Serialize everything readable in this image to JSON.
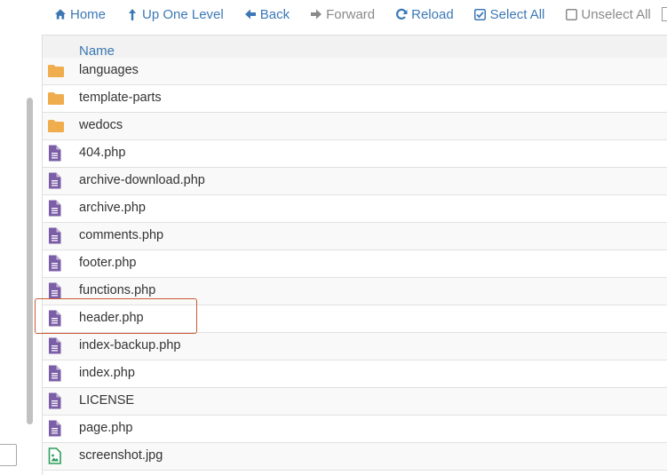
{
  "toolbar": {
    "home": "Home",
    "up_one_level": "Up One Level",
    "back": "Back",
    "forward": "Forward",
    "reload": "Reload",
    "select_all": "Select All",
    "unselect_all": "Unselect All"
  },
  "table": {
    "column_name": "Name"
  },
  "files": [
    {
      "name": "languages",
      "type": "folder"
    },
    {
      "name": "template-parts",
      "type": "folder"
    },
    {
      "name": "wedocs",
      "type": "folder"
    },
    {
      "name": "404.php",
      "type": "file"
    },
    {
      "name": "archive-download.php",
      "type": "file"
    },
    {
      "name": "archive.php",
      "type": "file"
    },
    {
      "name": "comments.php",
      "type": "file"
    },
    {
      "name": "footer.php",
      "type": "file"
    },
    {
      "name": "functions.php",
      "type": "file"
    },
    {
      "name": "header.php",
      "type": "file"
    },
    {
      "name": "index-backup.php",
      "type": "file"
    },
    {
      "name": "index.php",
      "type": "file"
    },
    {
      "name": "LICENSE",
      "type": "file"
    },
    {
      "name": "page.php",
      "type": "file"
    },
    {
      "name": "screenshot.jpg",
      "type": "image"
    },
    {
      "name": "",
      "type": "file"
    }
  ],
  "colors": {
    "link": "#3c78b5",
    "folder": "#f0ad4e",
    "file": "#7b5ea7",
    "image": "#2e9e5b",
    "highlight": "#c95a36"
  }
}
